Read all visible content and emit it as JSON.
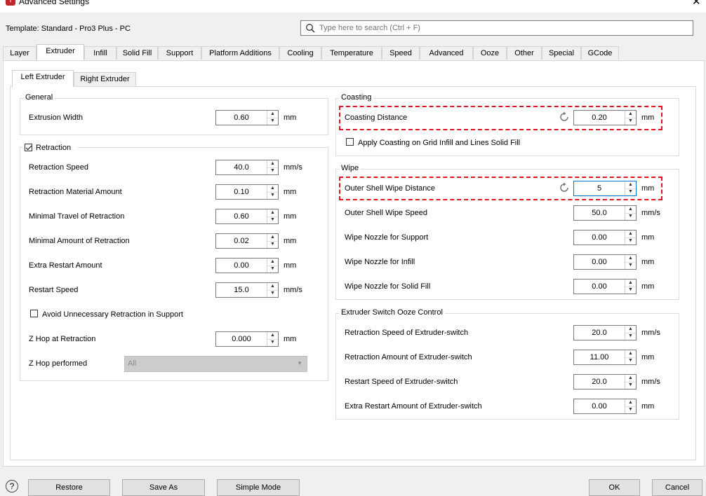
{
  "window": {
    "title": "Advanced Settings",
    "close_glyph": "✕",
    "icon_letter": "!"
  },
  "header": {
    "template_label": "Template: Standard - Pro3 Plus - PC",
    "search_placeholder": "Type here to search (Ctrl + F)"
  },
  "tabs": [
    "Layer",
    "Extruder",
    "Infill",
    "Solid Fill",
    "Support",
    "Platform Additions",
    "Cooling",
    "Temperature",
    "Speed",
    "Advanced",
    "Ooze",
    "Other",
    "Special",
    "GCode"
  ],
  "active_tab": "Extruder",
  "subtabs": [
    "Left Extruder",
    "Right Extruder"
  ],
  "left": {
    "general": {
      "title": "General",
      "extrusion_width": {
        "label": "Extrusion Width",
        "value": "0.60",
        "unit": "mm"
      }
    },
    "retraction": {
      "title": "Retraction",
      "checked": true,
      "rows": [
        {
          "label": "Retraction Speed",
          "value": "40.0",
          "unit": "mm/s"
        },
        {
          "label": "Retraction Material Amount",
          "value": "0.10",
          "unit": "mm"
        },
        {
          "label": "Minimal Travel of Retraction",
          "value": "0.60",
          "unit": "mm"
        },
        {
          "label": "Minimal Amount of Retraction",
          "value": "0.02",
          "unit": "mm"
        },
        {
          "label": "Extra Restart Amount",
          "value": "0.00",
          "unit": "mm"
        },
        {
          "label": "Restart Speed",
          "value": "15.0",
          "unit": "mm/s"
        }
      ],
      "avoid_label": "Avoid Unnecessary Retraction in Support",
      "avoid_checked": false,
      "zhop": {
        "label": "Z Hop at Retraction",
        "value": "0.000",
        "unit": "mm"
      },
      "zhop_performed": {
        "label": "Z Hop performed",
        "value": "All"
      }
    }
  },
  "right": {
    "coasting": {
      "title": "Coasting",
      "distance": {
        "label": "Coasting Distance",
        "value": "0.20",
        "unit": "mm"
      },
      "apply_label": "Apply Coasting on Grid Infill and Lines Solid Fill",
      "apply_checked": false
    },
    "wipe": {
      "title": "Wipe",
      "rows": [
        {
          "label": "Outer Shell Wipe Distance",
          "value": "5",
          "unit": "mm"
        },
        {
          "label": "Outer Shell Wipe Speed",
          "value": "50.0",
          "unit": "mm/s"
        },
        {
          "label": "Wipe Nozzle for Support",
          "value": "0.00",
          "unit": "mm"
        },
        {
          "label": "Wipe Nozzle for Infill",
          "value": "0.00",
          "unit": "mm"
        },
        {
          "label": "Wipe Nozzle for Solid Fill",
          "value": "0.00",
          "unit": "mm"
        }
      ]
    },
    "ooze": {
      "title": "Extruder Switch Ooze Control",
      "rows": [
        {
          "label": "Retraction Speed of Extruder-switch",
          "value": "20.0",
          "unit": "mm/s"
        },
        {
          "label": "Retraction Amount of Extruder-switch",
          "value": "11.00",
          "unit": "mm"
        },
        {
          "label": "Restart Speed of Extruder-switch",
          "value": "20.0",
          "unit": "mm/s"
        },
        {
          "label": "Extra Restart Amount of Extruder-switch",
          "value": "0.00",
          "unit": "mm"
        }
      ]
    }
  },
  "footer": {
    "help": "?",
    "restore": "Restore",
    "save_as": "Save As",
    "simple_mode": "Simple Mode",
    "ok": "OK",
    "cancel": "Cancel"
  },
  "colors": {
    "highlight": "#e0141e",
    "icon_red": "#c1272d"
  }
}
